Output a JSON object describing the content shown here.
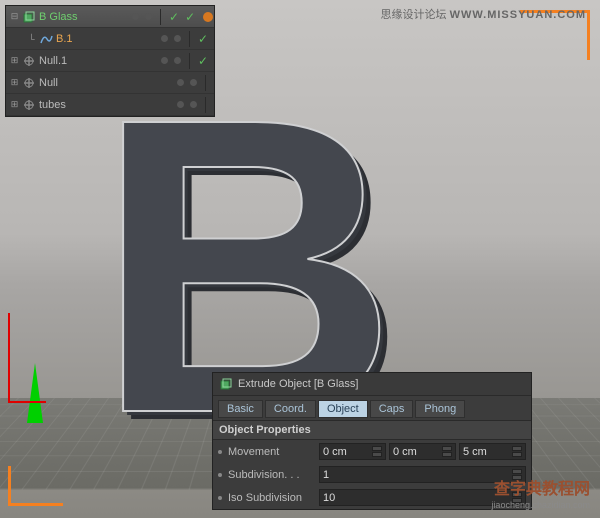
{
  "watermark": {
    "top": "思缘设计论坛 ",
    "top_url": "WWW.MISSYUAN.COM",
    "bottom_main": "查字典教程网",
    "bottom_sub": "jiaocheng.chazidian.com"
  },
  "objects": [
    {
      "name": "B Glass",
      "type": "extrude",
      "selected": true,
      "nameClass": "green",
      "expandable": true,
      "expanded": true,
      "toggles": [
        "dot",
        "dot",
        "sep",
        "check",
        "check",
        "tag"
      ],
      "indent": 0
    },
    {
      "name": "B.1",
      "type": "spline",
      "selected": false,
      "nameClass": "active",
      "expandable": false,
      "toggles": [
        "dot",
        "dot",
        "sep",
        "check"
      ],
      "indent": 1
    },
    {
      "name": "Null.1",
      "type": "null",
      "selected": false,
      "nameClass": "",
      "expandable": true,
      "expanded": false,
      "toggles": [
        "dot",
        "dot",
        "sep",
        "check"
      ],
      "indent": 0
    },
    {
      "name": "Null",
      "type": "null",
      "selected": false,
      "nameClass": "",
      "expandable": true,
      "expanded": false,
      "toggles": [
        "dot",
        "dot",
        "sep"
      ],
      "indent": 0
    },
    {
      "name": "tubes",
      "type": "null",
      "selected": false,
      "nameClass": "",
      "expandable": true,
      "expanded": false,
      "toggles": [
        "dot",
        "dot",
        "sep"
      ],
      "indent": 0
    }
  ],
  "attributes": {
    "header": "Extrude Object [B Glass]",
    "tabs": [
      "Basic",
      "Coord.",
      "Object",
      "Caps",
      "Phong"
    ],
    "active_tab": "Object",
    "section": "Object Properties",
    "rows": [
      {
        "label": "Movement",
        "values": [
          "0 cm",
          "0 cm",
          "5 cm"
        ]
      },
      {
        "label": "Subdivision. . .",
        "values": [
          "1"
        ]
      },
      {
        "label": "Iso Subdivision",
        "values": [
          "10"
        ]
      }
    ]
  }
}
